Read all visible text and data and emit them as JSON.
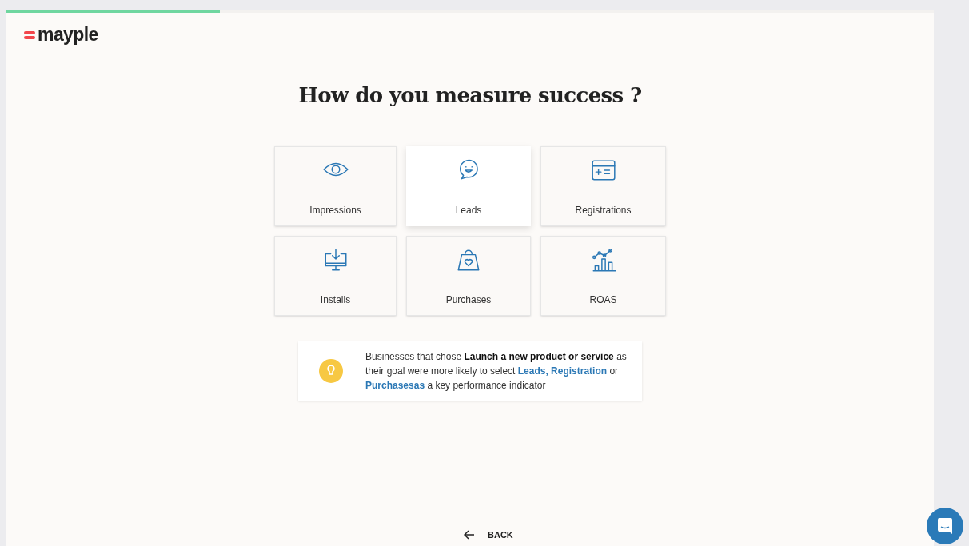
{
  "progress": {
    "level": 0.23
  },
  "logo": {
    "text": "mayple"
  },
  "title": "How do you measure success ?",
  "options": [
    {
      "label": "Impressions",
      "kind": "eye",
      "selected": false
    },
    {
      "label": "Leads",
      "kind": "chat",
      "selected": true
    },
    {
      "label": "Registrations",
      "kind": "form",
      "selected": false
    },
    {
      "label": "Installs",
      "kind": "download",
      "selected": false
    },
    {
      "label": "Purchases",
      "kind": "bag",
      "selected": false
    },
    {
      "label": "ROAS",
      "kind": "chart",
      "selected": false
    }
  ],
  "tip": {
    "segments": [
      {
        "kind": "plain",
        "text": "Businesses that chose "
      },
      {
        "kind": "bold",
        "text": "Launch a new product or service"
      },
      {
        "kind": "plain",
        "text": " as their goal were more likely to select "
      },
      {
        "kind": "link",
        "text": "Leads, Registration"
      },
      {
        "kind": "plain",
        "text": " or "
      },
      {
        "kind": "link",
        "text": "Purchasesas"
      },
      {
        "kind": "plain",
        "text": " a key performance indicator"
      }
    ]
  },
  "back_button": {
    "label": "BACK"
  }
}
